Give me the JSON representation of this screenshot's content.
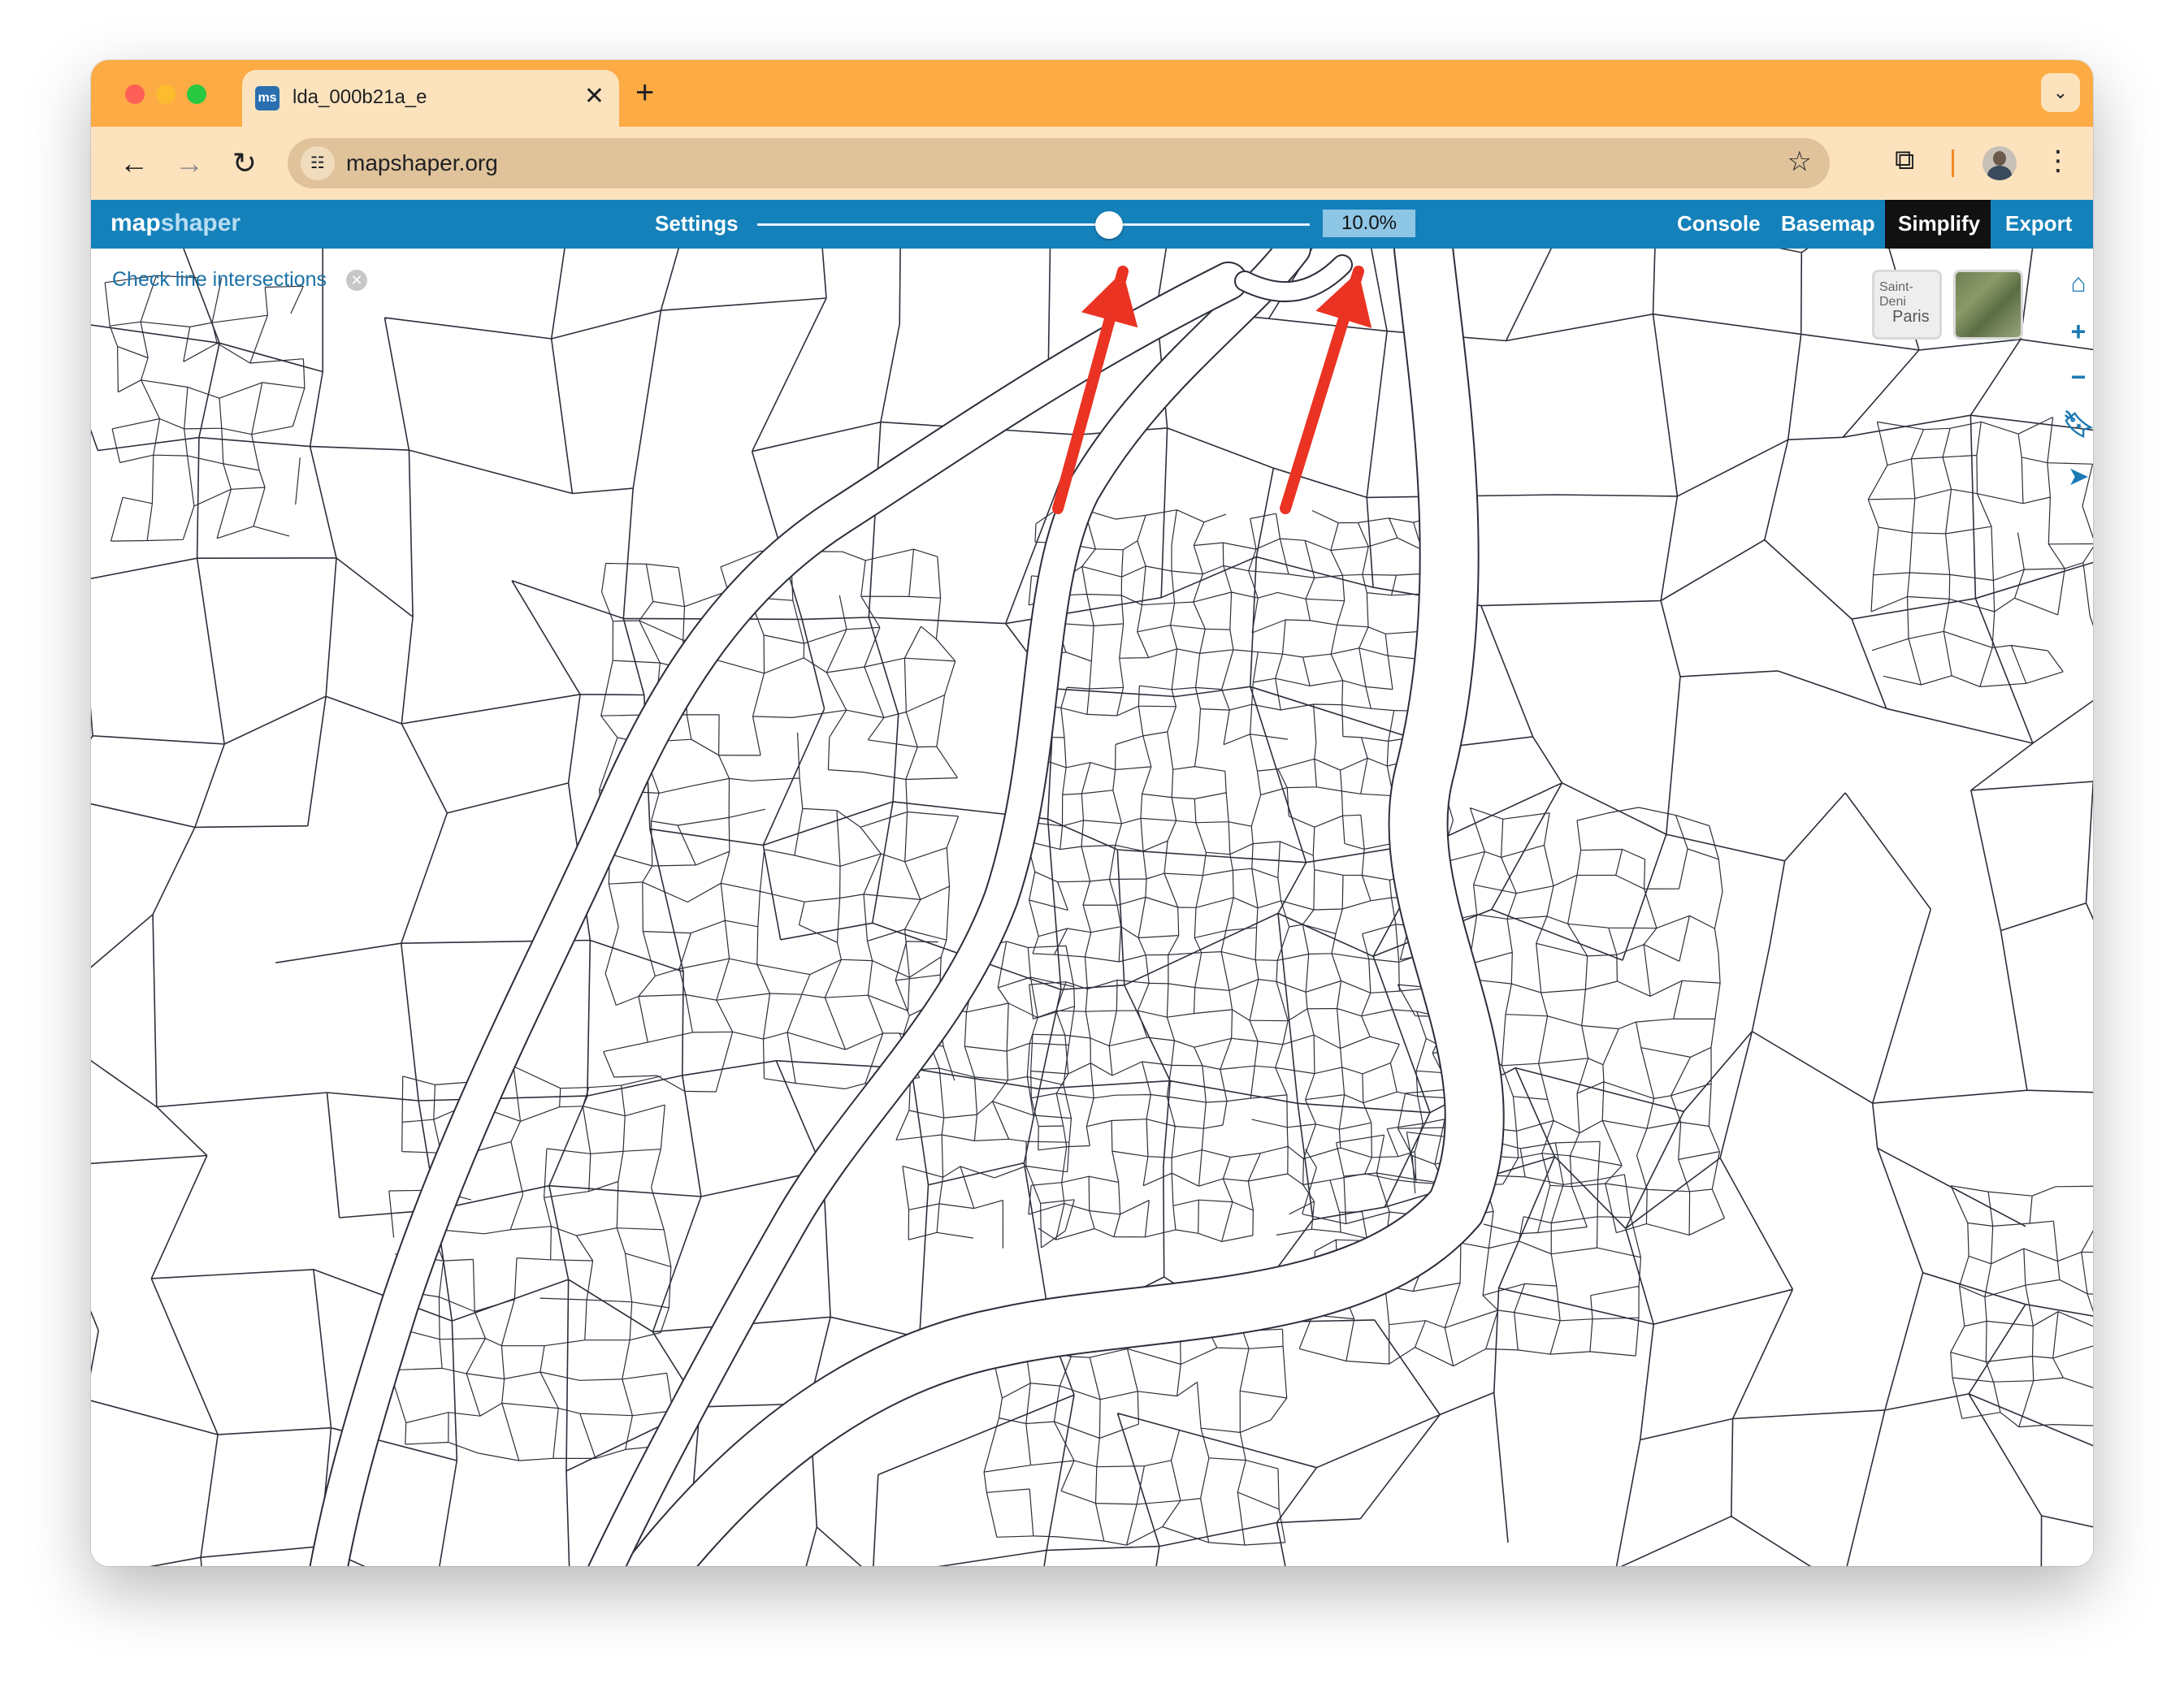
{
  "browser": {
    "tab_title": "lda_000b21a_e",
    "tab_favicon": "ms",
    "url": "mapshaper.org"
  },
  "app": {
    "logo_map": "map",
    "logo_shaper": "shaper",
    "settings_label": "Settings",
    "simplify_percent": "10.0%",
    "simplify_fraction": 0.1,
    "menu": {
      "console": "Console",
      "basemap": "Basemap",
      "simplify": "Simplify",
      "export": "Export"
    },
    "active_menu": "Simplify",
    "check_intersections_label": "Check line intersections"
  },
  "basemap_thumbs": {
    "paris_small": "Saint-Deni",
    "paris_large": "Paris"
  },
  "icons": {
    "home": "home-icon",
    "zoom_in": "zoom-in-icon",
    "zoom_out": "zoom-out-icon",
    "bookmark": "bookmark-icon",
    "select": "pointer-icon"
  },
  "colors": {
    "tab_strip": "#fdab45",
    "toolbar": "#fde3bd",
    "ms_header": "#1581ba",
    "annotation_arrow": "#ea3323"
  }
}
